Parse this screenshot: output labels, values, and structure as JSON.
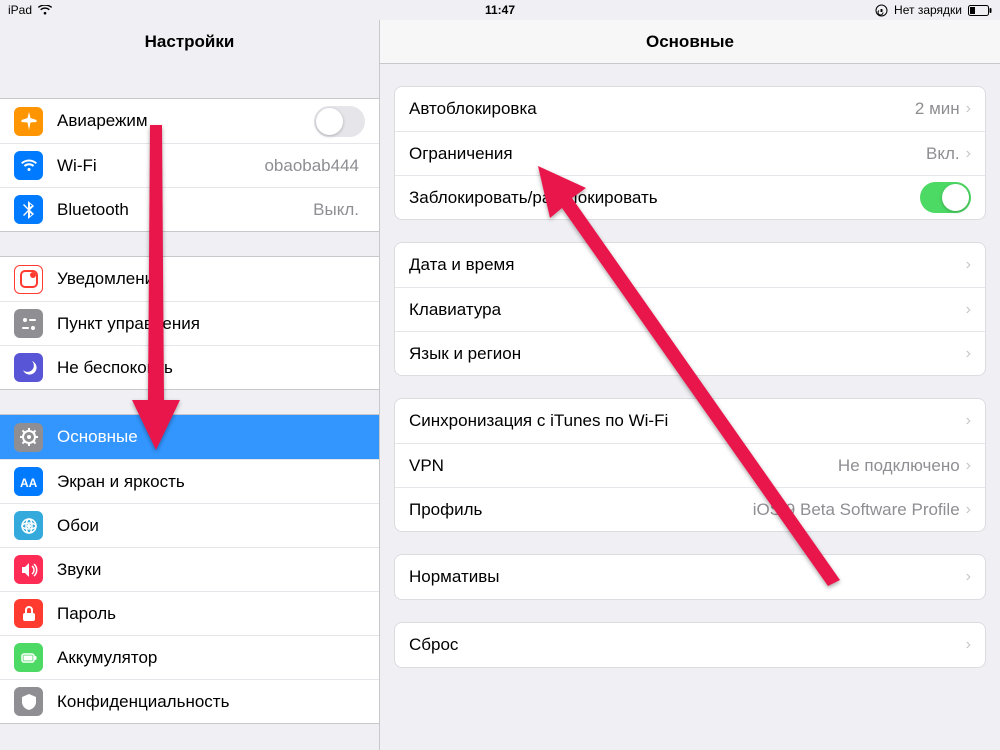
{
  "status": {
    "device": "iPad",
    "time": "11:47",
    "charge": "Нет зарядки"
  },
  "left": {
    "title": "Настройки",
    "g1": {
      "airplane": "Авиарежим",
      "wifi": "Wi-Fi",
      "wifi_val": "obaobab444",
      "bt": "Bluetooth",
      "bt_val": "Выкл."
    },
    "g2": {
      "notif": "Уведомления",
      "cc": "Пункт управления",
      "dnd": "Не беспокоить"
    },
    "g3": {
      "general": "Основные",
      "display": "Экран и яркость",
      "wallpaper": "Обои",
      "sounds": "Звуки",
      "passcode": "Пароль",
      "battery": "Аккумулятор",
      "privacy": "Конфиденциальность"
    }
  },
  "right": {
    "title": "Основные",
    "g1": {
      "autolock": "Автоблокировка",
      "autolock_val": "2 мин",
      "restrict": "Ограничения",
      "restrict_val": "Вкл.",
      "lockunlock": "Заблокировать/разблокировать"
    },
    "g2": {
      "date": "Дата и время",
      "keyboard": "Клавиатура",
      "lang": "Язык и регион"
    },
    "g3": {
      "itunes": "Синхронизация с iTunes по Wi-Fi",
      "vpn": "VPN",
      "vpn_val": "Не подключено",
      "profile": "Профиль",
      "profile_val": "iOS 9 Beta Software Profile"
    },
    "g4": {
      "regulatory": "Нормативы"
    },
    "g5": {
      "reset": "Сброс"
    }
  }
}
